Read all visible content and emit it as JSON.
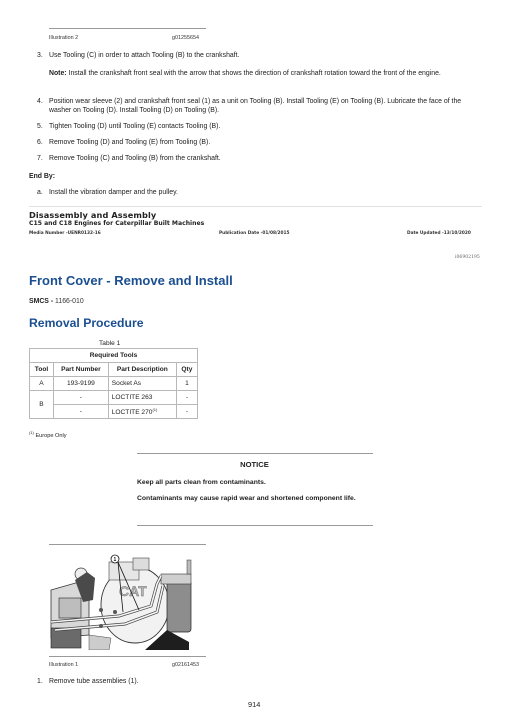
{
  "illustration_top": {
    "label": "Illustration 2",
    "code": "g01255654"
  },
  "steps_top": [
    {
      "num": "3.",
      "text": "Use Tooling (C) in order to attach Tooling (B) to the crankshaft."
    },
    {
      "num": "4.",
      "text": "Position wear sleeve (2) and crankshaft front seal (1) as a unit on Tooling (B). Install Tooling (E) on Tooling (B). Lubricate the face of the washer on Tooling (D). Install Tooling (D) on Tooling (B)."
    },
    {
      "num": "5.",
      "text": "Tighten Tooling (D) until Tooling (E) contacts Tooling (B)."
    },
    {
      "num": "6.",
      "text": "Remove Tooling (D) and Tooling (E) from Tooling (B)."
    },
    {
      "num": "7.",
      "text": "Remove Tooling (C) and Tooling (B) from the crankshaft."
    }
  ],
  "note": {
    "label": "Note:",
    "text": " Install the crankshaft front seal with the arrow that shows the direction of crankshaft rotation toward the front of the engine."
  },
  "end_by": {
    "label": "End By:",
    "items": [
      {
        "num": "a.",
        "text": "Install the vibration damper and the pulley."
      }
    ]
  },
  "doc_header": {
    "title": "Disassembly and Assembly",
    "subtitle": "C15 and C18 Engines for Caterpillar Built Machines",
    "media_number": "Media Number -UENR0132-16",
    "publication_date": "Publication Date -01/08/2015",
    "date_updated": "Date Updated -13/10/2020",
    "doc_id": "i06902195"
  },
  "section": {
    "title": "Front Cover - Remove and Install",
    "smcs_label": "SMCS - ",
    "smcs_value": "1166-010",
    "subsection": "Removal Procedure"
  },
  "table": {
    "caption": "Table 1",
    "title": "Required Tools",
    "headers": [
      "Tool",
      "Part Number",
      "Part Description",
      "Qty"
    ],
    "rows": [
      {
        "tool": "A",
        "part_number": "193-9199",
        "description": "Socket As",
        "qty": "1"
      },
      {
        "tool": "B",
        "part_number": "-",
        "description": "LOCTITE 263",
        "qty": "-"
      },
      {
        "tool": "",
        "part_number": "-",
        "description": "LOCTITE 270",
        "sup": "(1)",
        "qty": "-"
      }
    ],
    "footnote_mark": "(1)",
    "footnote": " Europe Only"
  },
  "notice": {
    "title": "NOTICE",
    "lines": [
      "Keep all parts clean from contaminants.",
      "Contaminants may cause rapid wear and shortened component life."
    ]
  },
  "illustration_bottom": {
    "label": "Illustration 1",
    "code": "g02161453",
    "callout": "1",
    "logo_text": "CAT"
  },
  "steps_bottom": [
    {
      "num": "1.",
      "text": "Remove tube assemblies (1)."
    }
  ],
  "page_number": "914"
}
